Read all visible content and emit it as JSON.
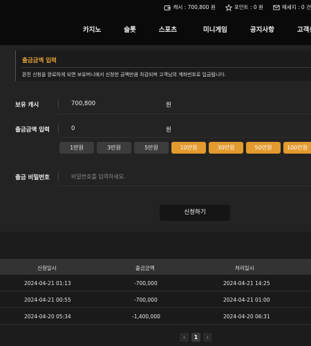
{
  "header": {
    "cash_label": "캐시 : 700,800 원",
    "point_label": "포인트 : 0 원",
    "message_label": "메세지 : 0 건",
    "nav": [
      "카지노",
      "슬롯",
      "스포츠",
      "미니게임",
      "공지사항",
      "고객센터"
    ]
  },
  "notice": {
    "title": "출금금액 입력",
    "text": "환전 신청을 완료하게 되면 보유머니에서 신청한 금액만큼 차감되며 고객님의 계좌번호로 입금됩니다."
  },
  "form": {
    "balance_label": "보유 캐시",
    "balance_value": "700,800",
    "unit": "원",
    "amount_label": "출금금액 입력",
    "amount_value": "0",
    "amount_buttons": [
      "1만원",
      "3만원",
      "5만원",
      "10만원",
      "30만원",
      "50만원",
      "100만원"
    ],
    "password_label": "출금 비밀번호",
    "password_placeholder": "비밀번호를 입력하세요.",
    "submit_label": "신청하기"
  },
  "table": {
    "headers": [
      "신청일시",
      "출금금액",
      "처리일시"
    ],
    "rows": [
      [
        "2024-04-21 01:13",
        "-700,000",
        "2024-04-21 14:25"
      ],
      [
        "2024-04-21 00:55",
        "-700,000",
        "2024-04-21 01:00"
      ],
      [
        "2024-04-20 05:34",
        "-1,400,000",
        "2024-04-20 06:31"
      ]
    ]
  },
  "pagination": {
    "prev": "‹",
    "current": "1",
    "next": "›"
  },
  "colors": {
    "accent": "#e39a2e",
    "background": "#1c1c1c"
  }
}
